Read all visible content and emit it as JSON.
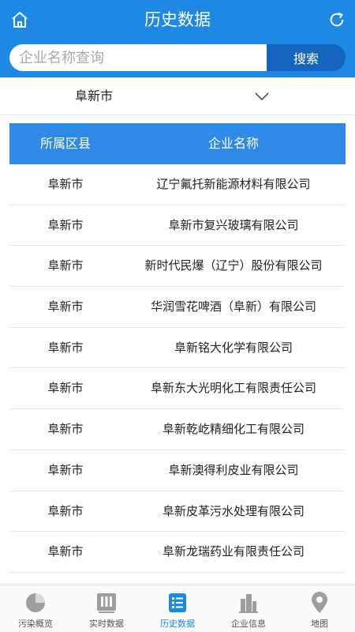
{
  "header": {
    "title": "历史数据"
  },
  "search": {
    "placeholder": "企业名称查询",
    "button_label": "搜索"
  },
  "filter": {
    "region": "阜新市"
  },
  "table": {
    "columns": [
      "所属区县",
      "企业名称"
    ],
    "rows": [
      [
        "阜新市",
        "辽宁氟托新能源材料有限公司"
      ],
      [
        "阜新市",
        "阜新市复兴玻璃有限公司"
      ],
      [
        "阜新市",
        "新时代民爆（辽宁）股份有限公司"
      ],
      [
        "阜新市",
        "华润雪花啤酒（阜新）有限公司"
      ],
      [
        "阜新市",
        "阜新铭大化学有限公司"
      ],
      [
        "阜新市",
        "阜新东大光明化工有限责任公司"
      ],
      [
        "阜新市",
        "阜新乾屹精细化工有限公司"
      ],
      [
        "阜新市",
        "阜新澳得利皮业有限公司"
      ],
      [
        "阜新市",
        "阜新皮革污水处理有限公司"
      ],
      [
        "阜新市",
        "阜新龙瑞药业有限责任公司"
      ]
    ]
  },
  "tabs": [
    {
      "label": "污染概览",
      "icon": "pie-chart-icon"
    },
    {
      "label": "实时数据",
      "icon": "bar-chart-icon"
    },
    {
      "label": "历史数据",
      "icon": "list-icon"
    },
    {
      "label": "企业信息",
      "icon": "building-icon"
    },
    {
      "label": "地图",
      "icon": "map-pin-icon"
    }
  ],
  "colors": {
    "primary": "#1e88e5",
    "button": "#1565c0",
    "table_header": "#2e8ae6"
  }
}
